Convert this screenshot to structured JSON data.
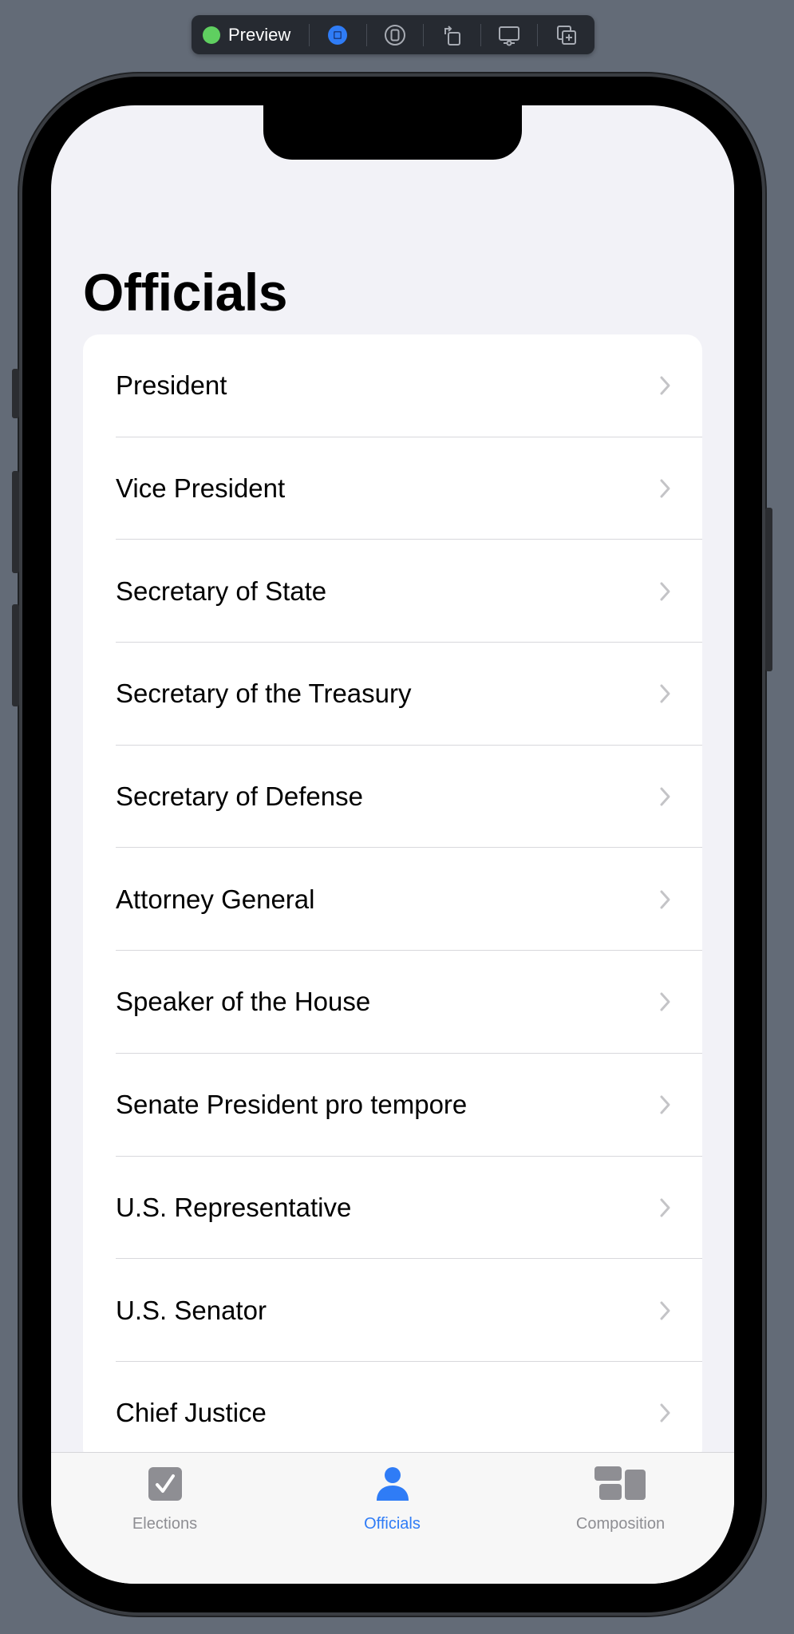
{
  "toolbar": {
    "preview_label": "Preview"
  },
  "screen": {
    "title": "Officials"
  },
  "officials": [
    "President",
    "Vice President",
    "Secretary of State",
    "Secretary of the Treasury",
    "Secretary of Defense",
    "Attorney General",
    "Speaker of the House",
    "Senate President pro tempore",
    "U.S. Representative",
    "U.S. Senator",
    "Chief Justice"
  ],
  "tabs": [
    {
      "label": "Elections",
      "icon": "checkmark-square-icon",
      "active": false
    },
    {
      "label": "Officials",
      "icon": "person-icon",
      "active": true
    },
    {
      "label": "Composition",
      "icon": "composition-icon",
      "active": false
    }
  ],
  "colors": {
    "accent": "#2f7cf6",
    "inactive": "#8e8e93",
    "background": "#f2f2f7"
  }
}
